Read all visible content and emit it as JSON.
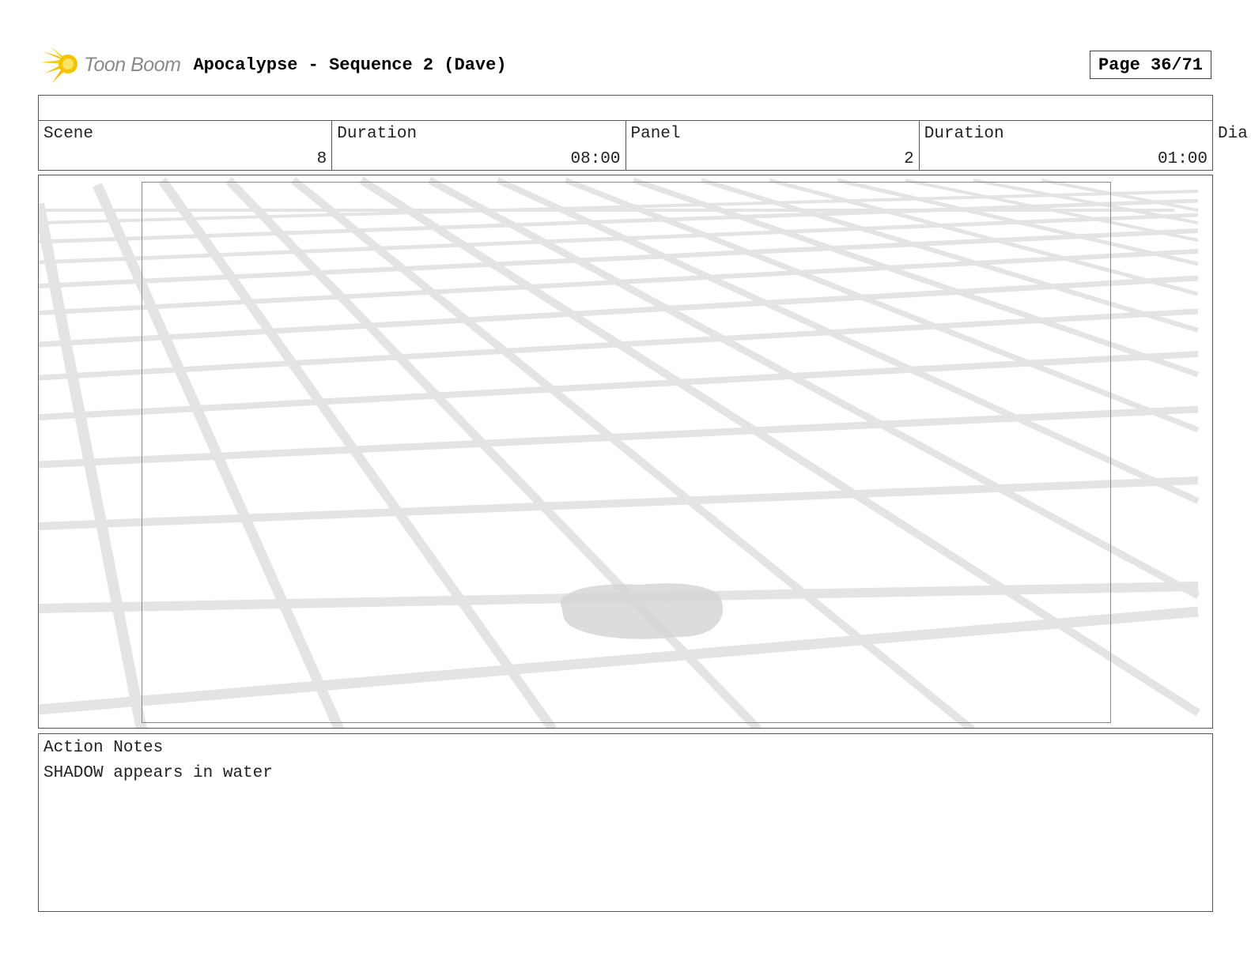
{
  "header": {
    "logo_text": "Toon Boom",
    "title": "Apocalypse - Sequence 2 (Dave)",
    "page": "Page 36/71"
  },
  "info": {
    "scene_label": "Scene",
    "scene_value": "8",
    "scene_duration_label": "Duration",
    "scene_duration_value": "08:00",
    "panel_label": "Panel",
    "panel_value": "2",
    "panel_duration_label": "Duration",
    "panel_duration_value": "01:00",
    "dialog_label": "Dia"
  },
  "notes": {
    "label": "Action Notes",
    "text": "SHADOW appears in water"
  },
  "colors": {
    "grid_line": "#e4e4e4",
    "shadow": "#d6d6d6",
    "logo_yellow": "#f5c400",
    "border": "#555555"
  },
  "icons": [
    "toon-boom-logo-icon"
  ]
}
